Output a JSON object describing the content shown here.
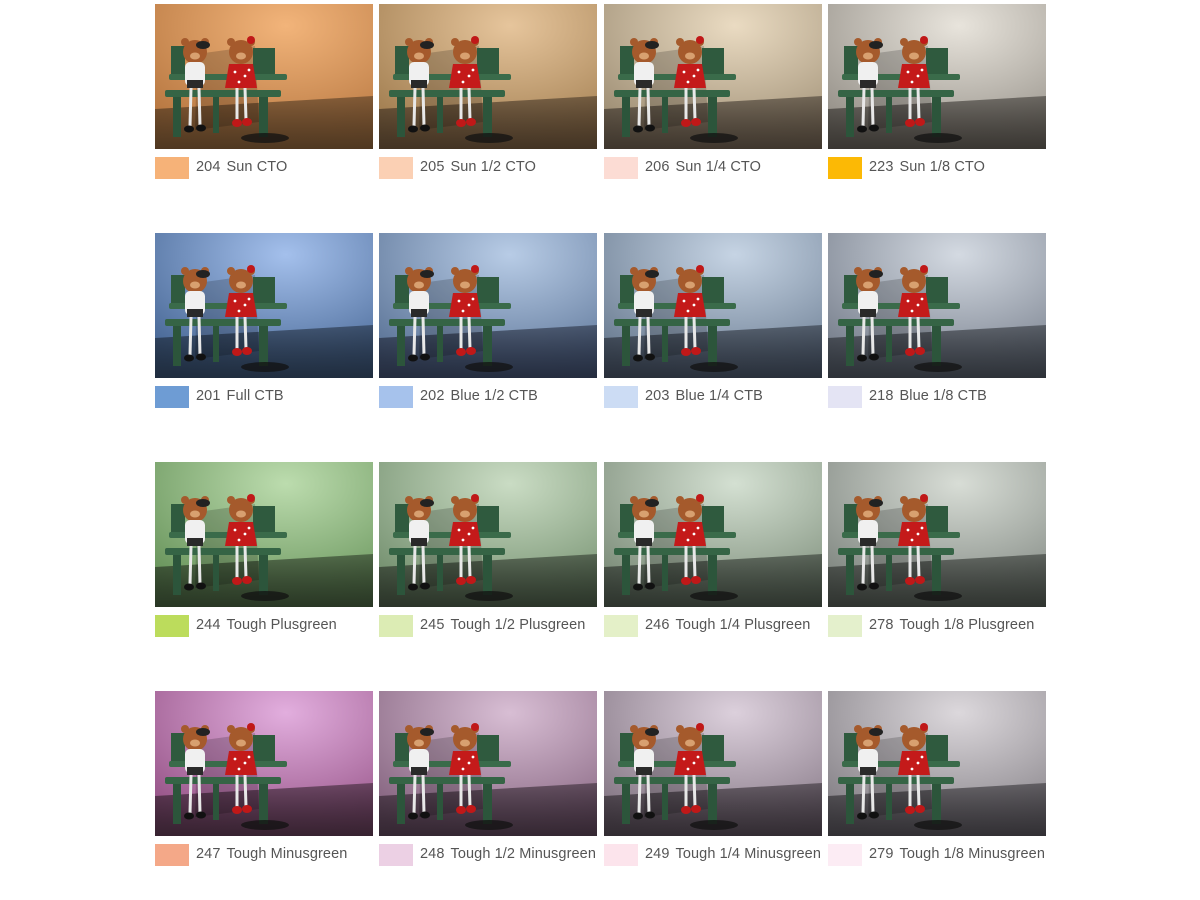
{
  "filters": [
    {
      "code": "204",
      "name": "Sun CTO",
      "swatch": "#f6b278",
      "bg_light": "#f2b47a",
      "bg_dark": "#b0703a",
      "floor": "#4a3520"
    },
    {
      "code": "205",
      "name": "Sun 1/2 CTO",
      "swatch": "#fbd0b4",
      "bg_light": "#e6c59c",
      "bg_dark": "#9a7648",
      "floor": "#3e3022"
    },
    {
      "code": "206",
      "name": "Sun 1/4 CTO",
      "swatch": "#fcdcd4",
      "bg_light": "#eadbc2",
      "bg_dark": "#96866c",
      "floor": "#3a322a"
    },
    {
      "code": "223",
      "name": "Sun 1/8 CTO",
      "swatch": "#fcb905",
      "bg_light": "#e8e4dc",
      "bg_dark": "#8d8880",
      "floor": "#35322e"
    },
    {
      "code": "201",
      "name": "Full CTB",
      "swatch": "#6e9cd4",
      "bg_light": "#a4c0ec",
      "bg_dark": "#3e5e8c",
      "floor": "#1e2a3a"
    },
    {
      "code": "202",
      "name": "Blue 1/2 CTB",
      "swatch": "#a6c2ec",
      "bg_light": "#b8cce6",
      "bg_dark": "#536c90",
      "floor": "#22293a"
    },
    {
      "code": "203",
      "name": "Blue 1/4 CTB",
      "swatch": "#ccdcf4",
      "bg_light": "#c6d4e4",
      "bg_dark": "#62748a",
      "floor": "#262c36"
    },
    {
      "code": "218",
      "name": "Blue 1/8 CTB",
      "swatch": "#e4e4f4",
      "bg_light": "#d4dae2",
      "bg_dark": "#6e7684",
      "floor": "#2a2e34"
    },
    {
      "code": "244",
      "name": "Tough Plusgreen",
      "swatch": "#bcdc5c",
      "bg_light": "#bcdcae",
      "bg_dark": "#5f8c52",
      "floor": "#263222"
    },
    {
      "code": "245",
      "name": "Tough 1/2 Plusgreen",
      "swatch": "#dcecb4",
      "bg_light": "#cadcc4",
      "bg_dark": "#6b8866",
      "floor": "#283026"
    },
    {
      "code": "246",
      "name": "Tough 1/4 Plusgreen",
      "swatch": "#e4f0c8",
      "bg_light": "#d4e0d2",
      "bg_dark": "#738470",
      "floor": "#2a302a"
    },
    {
      "code": "278",
      "name": "Tough 1/8 Plusgreen",
      "swatch": "#e4f0cc",
      "bg_light": "#d8ddd6",
      "bg_dark": "#777e78",
      "floor": "#2c302c"
    },
    {
      "code": "247",
      "name": "Tough Minusgreen",
      "swatch": "#f4a888",
      "bg_light": "#e2aede",
      "bg_dark": "#8e4a7e",
      "floor": "#32202c"
    },
    {
      "code": "248",
      "name": "Tough 1/2 Minusgreen",
      "swatch": "#ecd0e4",
      "bg_light": "#d8bed4",
      "bg_dark": "#7e5c78",
      "floor": "#30242e"
    },
    {
      "code": "249",
      "name": "Tough 1/4 Minusgreen",
      "swatch": "#fce4ec",
      "bg_light": "#dcd0dc",
      "bg_dark": "#7c6e7c",
      "floor": "#2e282e"
    },
    {
      "code": "279",
      "name": "Tough 1/8 Minusgreen",
      "swatch": "#fcecf4",
      "bg_light": "#dcd8dc",
      "bg_dark": "#7c787e",
      "floor": "#2e2c30"
    }
  ],
  "figurine_icon": "bears-on-bench-photo"
}
